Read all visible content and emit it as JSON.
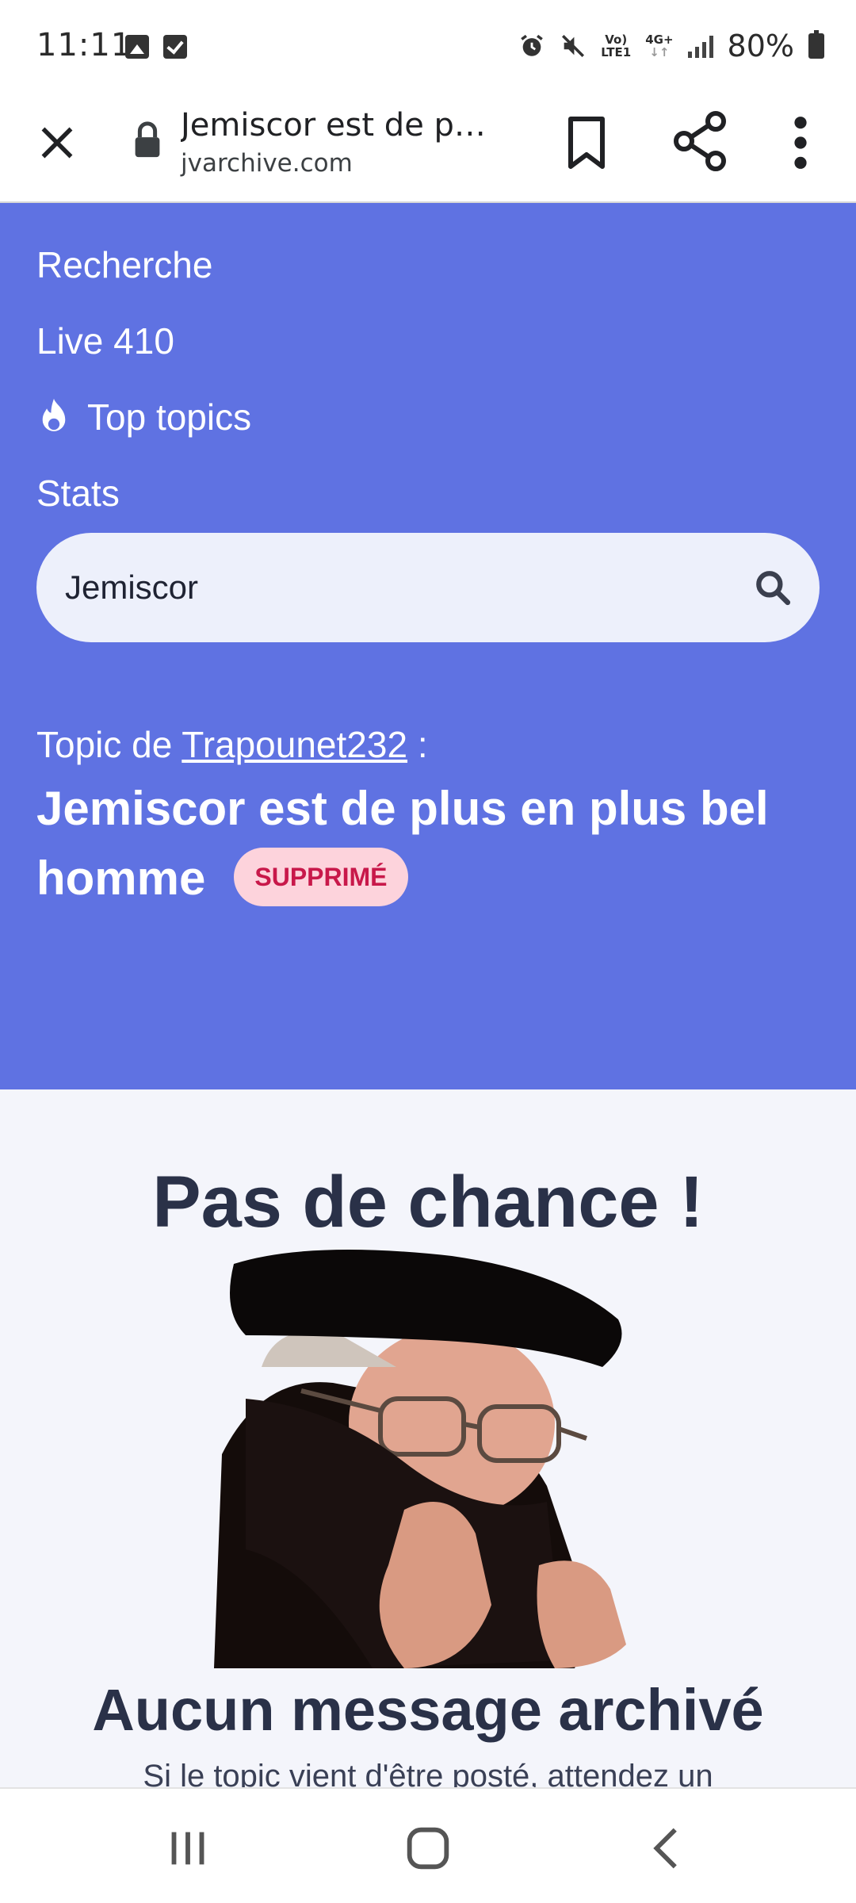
{
  "status_bar": {
    "time": "11:11",
    "network_top": "Vo)",
    "network_bottom": "LTE1",
    "network_4g": "4G+",
    "battery": "80%"
  },
  "browser": {
    "page_title": "Jemiscor est de p…",
    "domain": "jvarchive.com",
    "icons": [
      "close-icon",
      "lock-icon",
      "bookmark-icon",
      "share-icon",
      "more-vert-icon"
    ]
  },
  "nav": {
    "items": [
      {
        "label": "Recherche"
      },
      {
        "label": "Live 410"
      },
      {
        "label": "Top topics",
        "icon": "flame-icon"
      },
      {
        "label": "Stats"
      }
    ]
  },
  "search": {
    "value": "Jemiscor",
    "placeholder": ""
  },
  "topic": {
    "by_prefix": "Topic de",
    "author": "Trapounet232",
    "by_suffix": ":",
    "title": "Jemiscor est de plus en plus bel homme",
    "badge": "SUPPRIMÉ"
  },
  "empty_state": {
    "title": "Pas de chance !",
    "heading": "Aucun message archivé",
    "subtext": "Si le topic vient d'être posté, attendez un"
  },
  "colors": {
    "hero_bg": "#5f72e2",
    "content_bg": "#f4f5fb",
    "badge_bg": "#fdd3dc",
    "badge_text": "#c8184a",
    "heading_text": "#2a3148"
  }
}
